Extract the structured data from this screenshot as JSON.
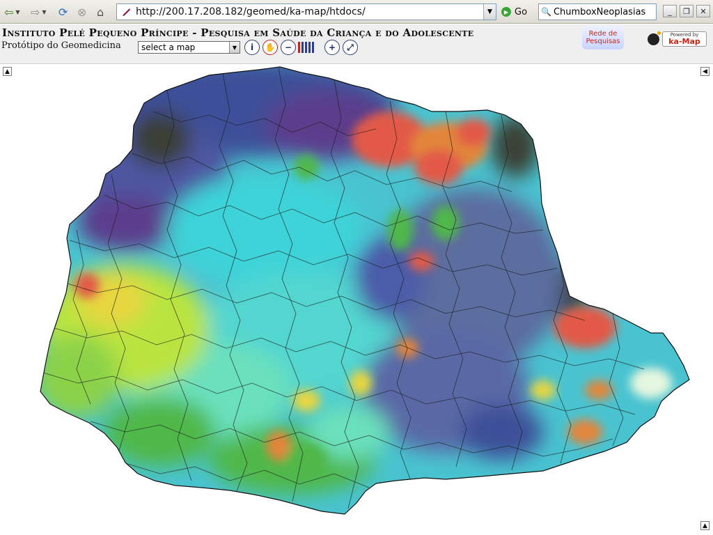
{
  "browser": {
    "url": "http://200.17.208.182/geomed/ka-map/htdocs/",
    "go_label": "Go",
    "search_value": "ChumboxNeoplasias",
    "buttons": [
      "back-icon",
      "forward-icon",
      "reload-icon",
      "stop-icon",
      "home-icon"
    ]
  },
  "header": {
    "title": "Instituto Pelé Pequeno Príncipe - Pesquisa em Saúde da Criança e do Adolescente",
    "subtitle": "Protótipo do Geomedicina",
    "map_select": "select a map",
    "logo_rede_line1": "Rede de",
    "logo_rede_line2": "Pesquisas",
    "powered_by": "Powered by",
    "kamap": "ka-Map"
  },
  "toolbar": {
    "tools": [
      "info-icon",
      "pan-icon",
      "zoom-out-icon",
      "zoom-level-icon",
      "zoom-in-icon",
      "zoom-extent-icon"
    ]
  },
  "map": {
    "colors": {
      "dark_blue": "#3d4f98",
      "slate": "#5b6d9f",
      "purple": "#5c3c8c",
      "cyan": "#3ed3d8",
      "mint": "#6be0bc",
      "green": "#4fb84a",
      "lime": "#b9e43f",
      "yellow": "#e7d640",
      "orange": "#e2853b",
      "red": "#e25a47",
      "dark": "#3a3f34"
    }
  }
}
